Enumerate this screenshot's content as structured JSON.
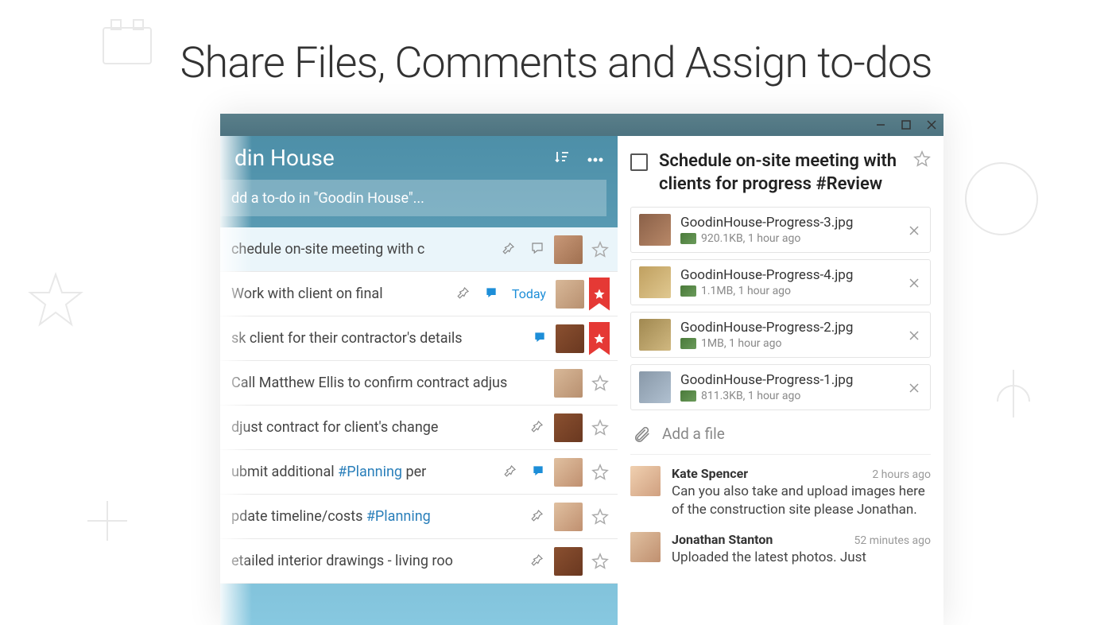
{
  "headline": "Share Files, Comments and Assign to-dos",
  "list": {
    "title": "din House",
    "add_placeholder": "dd a to-do in \"Goodin House\"...",
    "items": [
      {
        "text": "chedule on-site meeting with c",
        "pin": true,
        "comment": "outline",
        "due": "",
        "starred": false,
        "flag": false,
        "selected": true
      },
      {
        "text": "Work with client on final",
        "pin": true,
        "comment": "blue",
        "due": "Today",
        "starred": false,
        "flag": true,
        "selected": false
      },
      {
        "text": "sk client for their contractor's details",
        "pin": false,
        "comment": "blue",
        "due": "",
        "starred": false,
        "flag": true,
        "selected": false
      },
      {
        "text": "Call Matthew Ellis to confirm contract adjus",
        "pin": false,
        "comment": "",
        "due": "",
        "starred": false,
        "flag": false,
        "selected": false
      },
      {
        "text": "djust contract for client's change",
        "pin": true,
        "comment": "",
        "due": "",
        "starred": false,
        "flag": false,
        "selected": false
      },
      {
        "text": "ubmit additional ",
        "tag": "#Planning",
        "suffix": " per",
        "pin": true,
        "comment": "blue",
        "due": "",
        "starred": false,
        "flag": false,
        "selected": false
      },
      {
        "text": "pdate timeline/costs ",
        "tag": "#Planning",
        "suffix": "",
        "pin": true,
        "comment": "",
        "due": "",
        "starred": false,
        "flag": false,
        "selected": false
      },
      {
        "text": "etailed interior drawings - living roo",
        "pin": true,
        "comment": "",
        "due": "",
        "starred": false,
        "flag": false,
        "selected": false
      }
    ]
  },
  "detail": {
    "title": "Schedule on-site meeting with clients for progress #Review",
    "files": [
      {
        "name": "GoodinHouse-Progress-3.jpg",
        "meta": "920.1KB, 1 hour ago"
      },
      {
        "name": "GoodinHouse-Progress-4.jpg",
        "meta": "1.1MB, 1 hour ago"
      },
      {
        "name": "GoodinHouse-Progress-2.jpg",
        "meta": "1MB, 1 hour ago"
      },
      {
        "name": "GoodinHouse-Progress-1.jpg",
        "meta": "811.3KB, 1 hour ago"
      }
    ],
    "add_file_label": "Add a file",
    "comments": [
      {
        "author": "Kate Spencer",
        "time": "2 hours ago",
        "text": "Can you also take and upload images here of the construction site please Jonathan."
      },
      {
        "author": "Jonathan Stanton",
        "time": "52 minutes ago",
        "text": "Uploaded the latest photos. Just"
      }
    ]
  }
}
